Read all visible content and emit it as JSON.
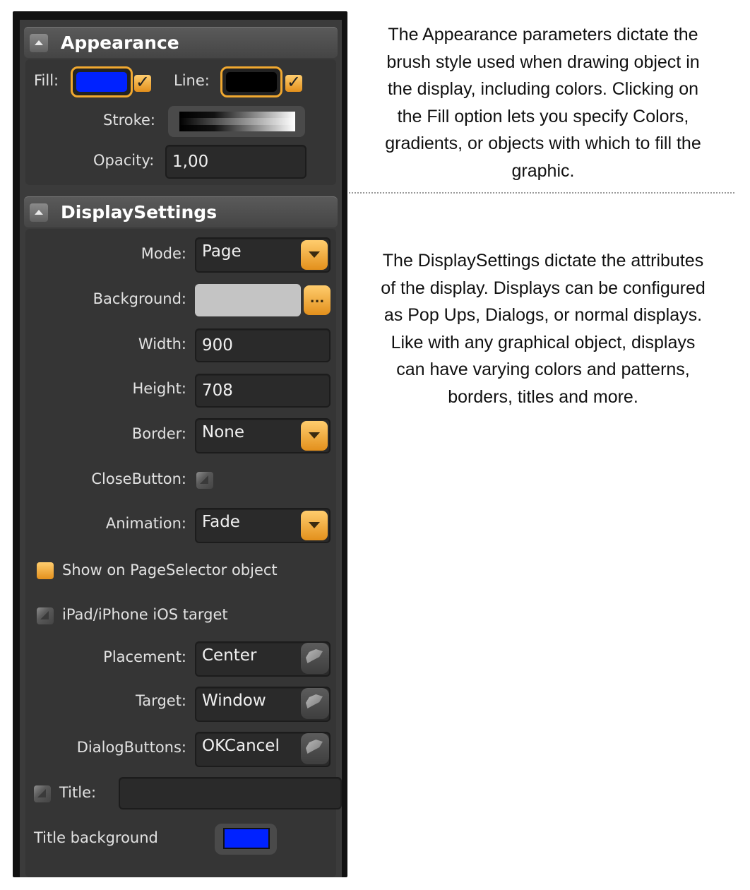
{
  "appearance": {
    "header": "Appearance",
    "fill_label": "Fill:",
    "fill_color": "#0022ff",
    "line_label": "Line:",
    "line_color": "#000000",
    "stroke_label": "Stroke:",
    "opacity_label": "Opacity:",
    "opacity_value": "1,00"
  },
  "display_settings": {
    "header": "DisplaySettings",
    "mode_label": "Mode:",
    "mode_value": "Page",
    "background_label": "Background:",
    "background_color": "#c4c4c4",
    "background_button": "...",
    "width_label": "Width:",
    "width_value": "900",
    "height_label": "Height:",
    "height_value": "708",
    "border_label": "Border:",
    "border_value": "None",
    "close_button_label": "CloseButton:",
    "animation_label": "Animation:",
    "animation_value": "Fade",
    "show_on_pageselector_label": "Show on PageSelector object",
    "ios_target_label": "iPad/iPhone iOS target",
    "placement_label": "Placement:",
    "placement_value": "Center",
    "target_label": "Target:",
    "target_value": "Window",
    "dialog_buttons_label": "DialogButtons:",
    "dialog_buttons_value": "OKCancel",
    "title_label": "Title:",
    "title_value": "",
    "title_background_label": "Title background",
    "title_background_color": "#0022ff"
  },
  "descriptions": {
    "appearance_text_lines": [
      "The Appearance parameters dictate the",
      "brush style used when drawing object in",
      "the display, including colors.  Clicking on",
      "the Fill option lets you specify Colors,",
      "gradients, or objects with which to fill the",
      "graphic."
    ],
    "display_text_lines": [
      "The DisplaySettings dictate the attributes",
      "of the display.  Displays can be configured",
      "as Pop Ups, Dialogs, or normal displays.",
      "Like with any graphical object,  displays",
      "can have varying colors and patterns,",
      "borders, titles and more."
    ]
  },
  "colors": {
    "accent": "#f0a830",
    "panel_bg": "#3b3b3b"
  }
}
